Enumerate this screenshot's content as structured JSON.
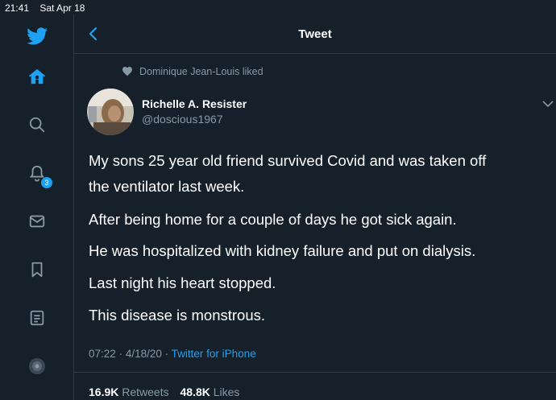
{
  "status_bar": {
    "time": "21:41",
    "date": "Sat Apr 18"
  },
  "sidebar": {
    "items": [
      {
        "name": "twitter-logo-icon"
      },
      {
        "name": "home-icon"
      },
      {
        "name": "search-icon"
      },
      {
        "name": "notifications-icon",
        "badge": "3"
      },
      {
        "name": "messages-icon"
      },
      {
        "name": "bookmarks-icon"
      },
      {
        "name": "lists-icon"
      },
      {
        "name": "profile-icon"
      }
    ]
  },
  "header": {
    "title": "Tweet"
  },
  "social_context": {
    "text": "Dominique Jean-Louis liked"
  },
  "author": {
    "name": "Richelle A. Resister",
    "handle": "@doscious1967"
  },
  "tweet": {
    "lines": [
      "My sons 25 year old friend survived Covid and was taken off",
      "the ventilator last week.",
      "After being home for a couple of days he got sick again.",
      "He was hospitalized with kidney failure and put on dialysis.",
      "Last night his heart stopped.",
      "This disease is monstrous."
    ],
    "time": "07:22",
    "date": "4/18/20",
    "separator": "·",
    "client": "Twitter for iPhone"
  },
  "stats": {
    "retweets_count": "16.9K",
    "retweets_label": "Retweets",
    "likes_count": "48.8K",
    "likes_label": "Likes"
  },
  "colors": {
    "background": "#15202b",
    "accent": "#1da1f2",
    "secondary_text": "#8899a6"
  }
}
